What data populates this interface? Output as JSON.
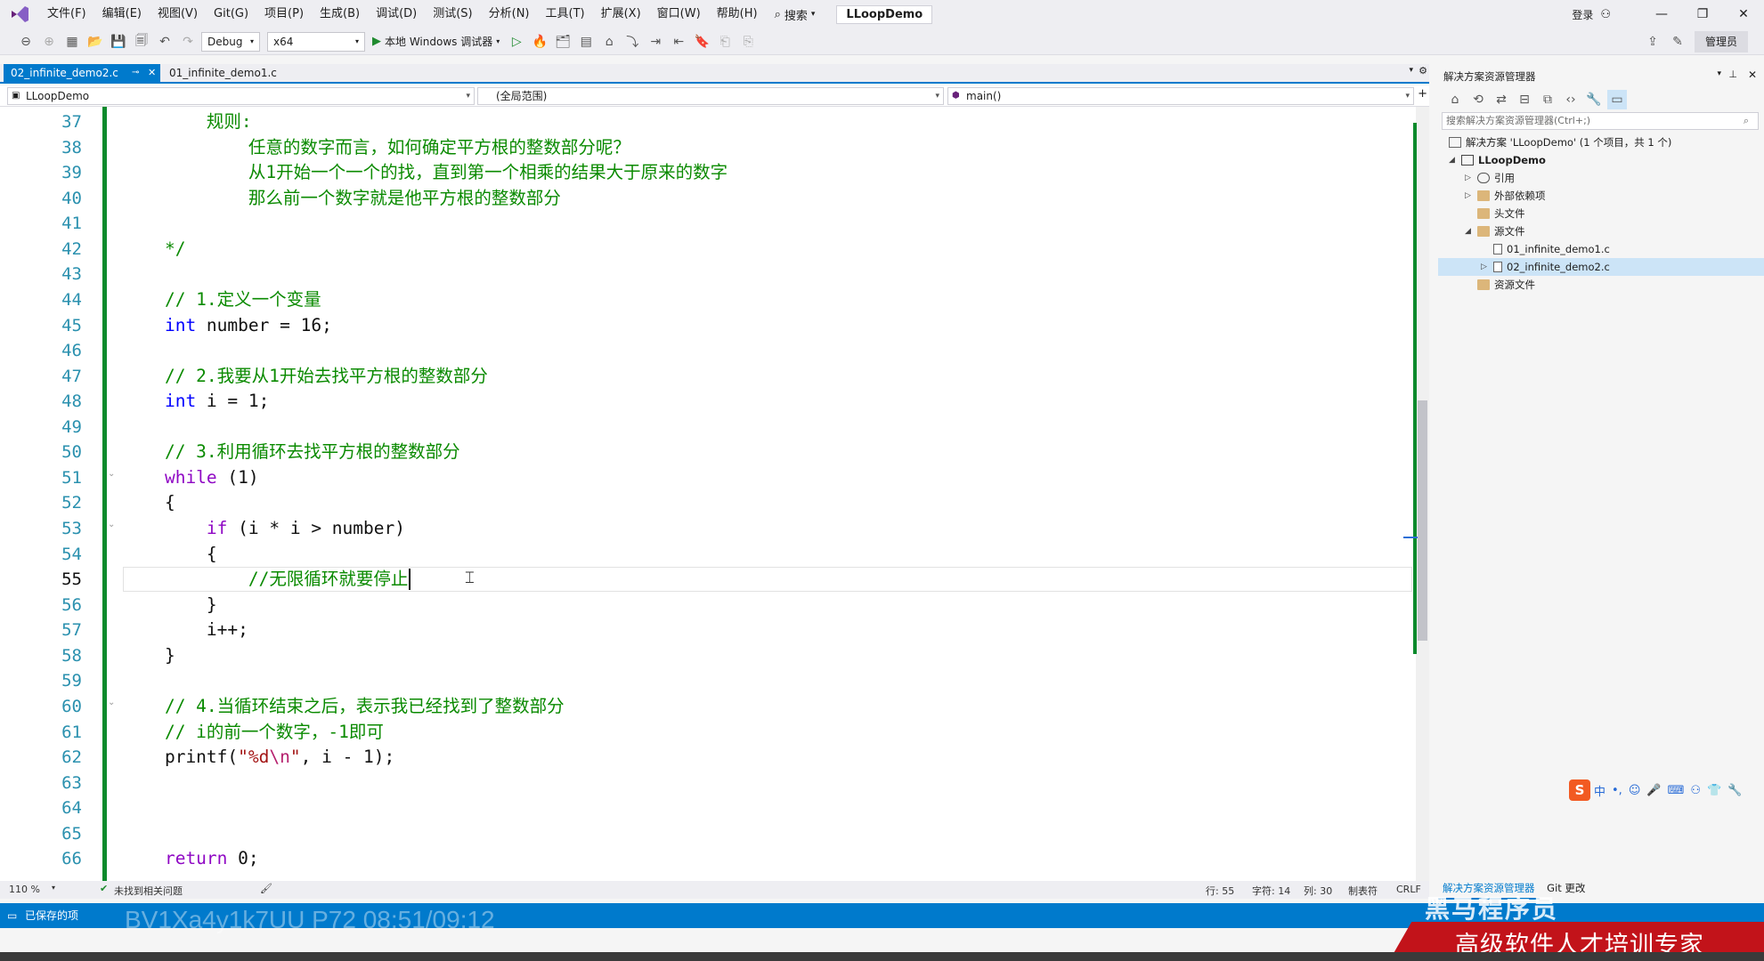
{
  "titlebar": {
    "menus": [
      "文件(F)",
      "编辑(E)",
      "视图(V)",
      "Git(G)",
      "项目(P)",
      "生成(B)",
      "调试(D)",
      "测试(S)",
      "分析(N)",
      "工具(T)",
      "扩展(X)",
      "窗口(W)",
      "帮助(H)"
    ],
    "search_label": "搜索",
    "project_name": "LLoopDemo",
    "login_label": "登录"
  },
  "toolbar": {
    "config": "Debug",
    "platform": "x64",
    "run_label": "本地 Windows 调试器",
    "admin_label": "管理员"
  },
  "tabs": [
    {
      "label": "02_infinite_demo2.c",
      "active": true
    },
    {
      "label": "01_infinite_demo1.c",
      "active": false
    }
  ],
  "navbar": {
    "project": "LLoopDemo",
    "scope": "(全局范围)",
    "function": "main()"
  },
  "editor": {
    "current_line": 55,
    "lines": [
      {
        "n": "37",
        "t": [
          [
            "cm",
            "        规则:"
          ]
        ]
      },
      {
        "n": "38",
        "t": [
          [
            "cm",
            "            任意的数字而言，如何确定平方根的整数部分呢？"
          ]
        ]
      },
      {
        "n": "39",
        "t": [
          [
            "cm",
            "            从1开始一个一个的找，直到第一个相乘的结果大于原来的数字"
          ]
        ]
      },
      {
        "n": "40",
        "t": [
          [
            "cm",
            "            那么前一个数字就是他平方根的整数部分"
          ]
        ]
      },
      {
        "n": "41",
        "t": []
      },
      {
        "n": "42",
        "t": [
          [
            "cm",
            "    */"
          ]
        ]
      },
      {
        "n": "43",
        "t": []
      },
      {
        "n": "44",
        "t": [
          [
            "cm",
            "    // 1.定义一个变量"
          ]
        ]
      },
      {
        "n": "45",
        "t": [
          [
            "kw",
            "    int"
          ],
          [
            "tx",
            " number = 16;"
          ]
        ]
      },
      {
        "n": "46",
        "t": []
      },
      {
        "n": "47",
        "t": [
          [
            "cm",
            "    // 2.我要从1开始去找平方根的整数部分"
          ]
        ]
      },
      {
        "n": "48",
        "t": [
          [
            "kw",
            "    int"
          ],
          [
            "tx",
            " i = 1;"
          ]
        ]
      },
      {
        "n": "49",
        "t": []
      },
      {
        "n": "50",
        "t": [
          [
            "cm",
            "    // 3.利用循环去找平方根的整数部分"
          ]
        ]
      },
      {
        "n": "51",
        "t": [
          [
            "kw2",
            "    while"
          ],
          [
            "tx",
            " (1)"
          ]
        ]
      },
      {
        "n": "52",
        "t": [
          [
            "tx",
            "    {"
          ]
        ]
      },
      {
        "n": "53",
        "t": [
          [
            "kw2",
            "        if"
          ],
          [
            "tx",
            " (i * i > number)"
          ]
        ]
      },
      {
        "n": "54",
        "t": [
          [
            "tx",
            "        {"
          ]
        ]
      },
      {
        "n": "55",
        "t": [
          [
            "cm",
            "            //无限循环就要停止"
          ]
        ]
      },
      {
        "n": "56",
        "t": [
          [
            "tx",
            "        }"
          ]
        ]
      },
      {
        "n": "57",
        "t": [
          [
            "tx",
            "        i++;"
          ]
        ]
      },
      {
        "n": "58",
        "t": [
          [
            "tx",
            "    }"
          ]
        ]
      },
      {
        "n": "59",
        "t": []
      },
      {
        "n": "60",
        "t": [
          [
            "cm",
            "    // 4.当循环结束之后，表示我已经找到了整数部分"
          ]
        ]
      },
      {
        "n": "61",
        "t": [
          [
            "cm",
            "    // i的前一个数字，-1即可"
          ]
        ]
      },
      {
        "n": "62",
        "t": [
          [
            "tx",
            "    printf("
          ],
          [
            "str",
            "\"%d"
          ],
          [
            "esc",
            "\\n"
          ],
          [
            "str",
            "\""
          ],
          [
            "tx",
            ", i - 1);"
          ]
        ]
      },
      {
        "n": "63",
        "t": []
      },
      {
        "n": "64",
        "t": []
      },
      {
        "n": "65",
        "t": []
      },
      {
        "n": "66",
        "t": [
          [
            "kw2",
            "    return"
          ],
          [
            "tx",
            " 0;"
          ]
        ]
      }
    ]
  },
  "editor_status": {
    "zoom": "110 %",
    "issues": "未找到相关问题",
    "row": "行: 55",
    "char": "字符: 14",
    "col": "列: 30",
    "indent": "制表符",
    "eol": "CRLF"
  },
  "statusbar": {
    "saved": "已保存的项",
    "video_id": "BV1Xa4y1k7UU P72 08:51/09:12"
  },
  "solution_explorer": {
    "title": "解决方案资源管理器",
    "search_placeholder": "搜索解决方案资源管理器(Ctrl+;)",
    "solution_label": "解决方案 'LLoopDemo' (1 个项目，共 1 个)",
    "project": "LLoopDemo",
    "nodes": [
      "引用",
      "外部依赖项",
      "头文件",
      "源文件",
      "01_infinite_demo1.c",
      "02_infinite_demo2.c",
      "资源文件"
    ],
    "bottom_tabs": [
      "解决方案资源管理器",
      "Git 更改"
    ]
  },
  "watermark": {
    "brand": "黑马程序员",
    "slogan": "高级软件人才培训专家"
  },
  "colors": {
    "accent": "#007acc",
    "comment": "#0a8a00",
    "keyword": "#0000ff",
    "control": "#8f08c4",
    "string": "#a31515",
    "banner": "#c2131a"
  }
}
